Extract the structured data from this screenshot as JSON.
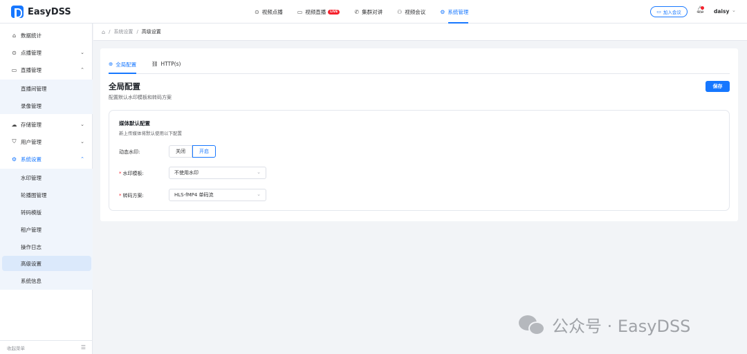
{
  "app": {
    "name": "EasyDSS"
  },
  "topnav": {
    "items": [
      {
        "label": "视频点播",
        "icon": "play-circle-icon"
      },
      {
        "label": "视频直播",
        "icon": "video-camera-icon",
        "badge": "LIVE"
      },
      {
        "label": "集群对讲",
        "icon": "phone-icon"
      },
      {
        "label": "视频会议",
        "icon": "people-icon"
      },
      {
        "label": "系统管理",
        "icon": "gear-icon",
        "active": true
      }
    ],
    "join_meeting": "加入会议",
    "user": "daisy"
  },
  "sidebar": {
    "items": [
      {
        "label": "数据统计",
        "icon": "home-icon"
      },
      {
        "label": "点播管理",
        "icon": "play-circle-icon"
      },
      {
        "label": "直播管理",
        "icon": "video-camera-icon"
      },
      {
        "label": "存储管理",
        "icon": "cloud-icon"
      },
      {
        "label": "用户管理",
        "icon": "shield-icon"
      },
      {
        "label": "系统设置",
        "icon": "gear-icon",
        "active": true
      }
    ],
    "live_sub": [
      "直播间管理",
      "录像管理"
    ],
    "system_sub": [
      "水印管理",
      "轮播图管理",
      "转码模版",
      "租户管理",
      "操作日志",
      "高级设置",
      "系统信息"
    ],
    "collapse_label": "收起菜单"
  },
  "breadcrumb": {
    "items": [
      "系统设置",
      "高级设置"
    ]
  },
  "tabs": [
    {
      "label": "全局配置",
      "icon": "globe-icon",
      "active": true
    },
    {
      "label": "HTTP(s)",
      "icon": "link-icon"
    }
  ],
  "section": {
    "title": "全局配置",
    "description": "配置默认水印模板和转码方案",
    "save_label": "保存"
  },
  "media_config": {
    "title": "媒体默认配置",
    "description": "新上传媒体将默认使用以下配置",
    "dynamic_watermark": {
      "label": "动态水印:",
      "off": "关闭",
      "on": "开启",
      "selected": "开启"
    },
    "watermark_template": {
      "label": "水印模板:",
      "value": "不使用水印"
    },
    "transcode_plan": {
      "label": "转码方案:",
      "value": "HLS-fMP4 单码流"
    }
  },
  "watermark": {
    "text": "公众号 · EasyDSS"
  },
  "colors": {
    "accent": "#1677ff",
    "live_badge": "#f5222d",
    "active_submenu_bg": "#dbe9fb"
  }
}
